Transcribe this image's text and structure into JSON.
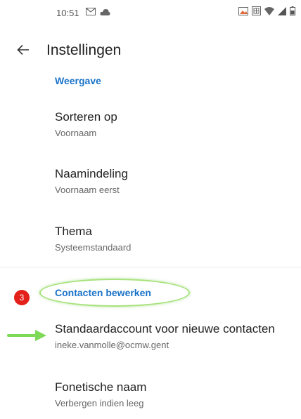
{
  "status_bar": {
    "time": "10:51",
    "left_icons": [
      "gmail-icon",
      "cloud-icon"
    ],
    "right_icons": [
      "image-icon",
      "sim-icon",
      "wifi-icon",
      "signal-icon",
      "battery-icon"
    ]
  },
  "app_bar": {
    "title": "Instellingen"
  },
  "sections": {
    "display": {
      "header": "Weergave",
      "items": [
        {
          "title": "Sorteren op",
          "summary": "Voornaam"
        },
        {
          "title": "Naamindeling",
          "summary": "Voornaam eerst"
        },
        {
          "title": "Thema",
          "summary": "Systeemstandaard"
        }
      ]
    },
    "edit_contacts": {
      "header": "Contacten bewerken",
      "items": [
        {
          "title": "Standaardaccount voor nieuwe contacten",
          "summary": "ineke.vanmolle@ocmw.gent"
        },
        {
          "title": "Fonetische naam",
          "summary": "Verbergen indien leeg"
        }
      ]
    }
  },
  "annotation": {
    "step_number": "3",
    "badge_color": "#e32019",
    "highlight_color": "#a6e27a",
    "arrow_color": "#7ed957"
  },
  "colors": {
    "accent": "#1a73c8",
    "title_text": "#222222",
    "summary_text": "#666666"
  }
}
